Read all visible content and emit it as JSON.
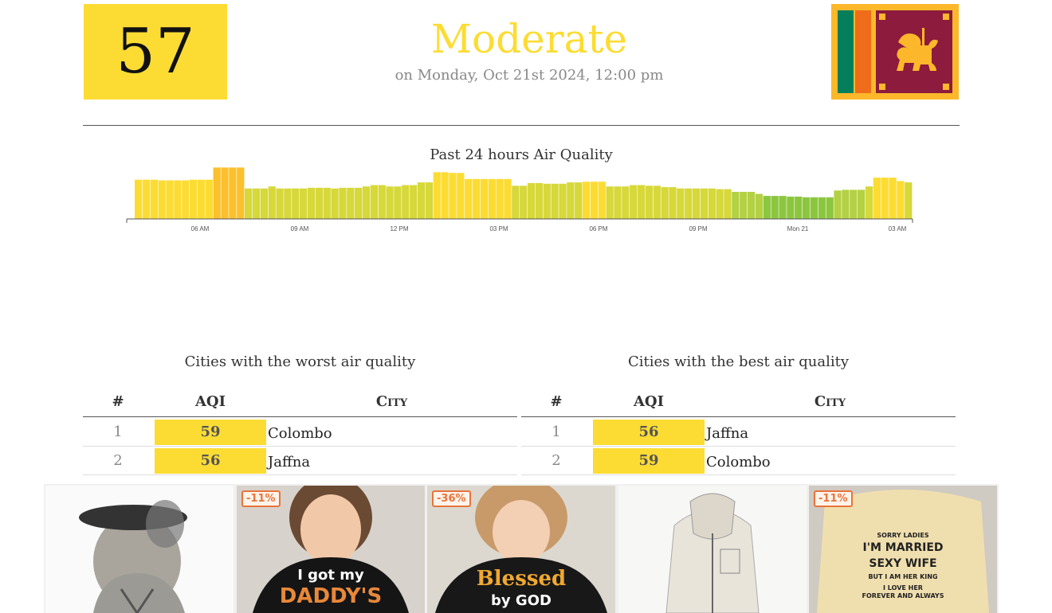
{
  "header": {
    "aqi_value": "57",
    "status": "Moderate",
    "timestamp": "on Monday, Oct 21st 2024, 12:00 pm",
    "colors": {
      "moderate": "#fcdc33"
    }
  },
  "chart": {
    "title": "Past 24 hours Air Quality"
  },
  "chart_data": {
    "type": "bar",
    "title": "Past 24 hours Air Quality",
    "x_tick_labels": [
      "06 AM",
      "09 AM",
      "12 PM",
      "03 PM",
      "06 PM",
      "09 PM",
      "Mon 21",
      "03 AM"
    ],
    "values": [
      58,
      58,
      58,
      57,
      57,
      57,
      57,
      58,
      58,
      58,
      76,
      76,
      76,
      76,
      45,
      45,
      45,
      48,
      45,
      45,
      45,
      45,
      46,
      46,
      46,
      45,
      46,
      46,
      46,
      48,
      50,
      50,
      48,
      48,
      50,
      50,
      54,
      54,
      69,
      69,
      68,
      68,
      59,
      59,
      59,
      59,
      59,
      59,
      49,
      49,
      53,
      53,
      52,
      52,
      52,
      54,
      54,
      55,
      55,
      55,
      48,
      48,
      48,
      50,
      50,
      49,
      49,
      47,
      47,
      45,
      45,
      45,
      45,
      45,
      44,
      44,
      40,
      40,
      40,
      37,
      34,
      34,
      34,
      33,
      33,
      32,
      32,
      32,
      32,
      42,
      43,
      43,
      43,
      48,
      61,
      61,
      61,
      56,
      54
    ],
    "ylim": [
      0,
      100
    ],
    "grid": false
  },
  "worst": {
    "title": "Cities with the worst air quality",
    "headers": {
      "rank": "#",
      "aqi": "AQI",
      "city": "City"
    },
    "rows": [
      {
        "rank": "1",
        "aqi": "59",
        "city": "Colombo"
      },
      {
        "rank": "2",
        "aqi": "56",
        "city": "Jaffna"
      }
    ]
  },
  "best": {
    "title": "Cities with the best air quality",
    "headers": {
      "rank": "#",
      "aqi": "AQI",
      "city": "City"
    },
    "rows": [
      {
        "rank": "1",
        "aqi": "56",
        "city": "Jaffna"
      },
      {
        "rank": "2",
        "aqi": "59",
        "city": "Colombo"
      }
    ]
  },
  "ads": {
    "badges": [
      "-11%",
      "-36%",
      "-11%"
    ],
    "shirt1": [
      "I got my",
      "DADDY'S"
    ],
    "shirt2": [
      "Blessed",
      "by GOD"
    ],
    "shirt3": [
      "SORRY LADIES",
      "I'M MARRIED",
      "SEXY WIFE",
      "BUT I AM HER KING",
      "I LOVE HER",
      "FOREVER AND ALWAYS"
    ],
    "adchoices_icon": "adchoices-icon",
    "close_icon": "close-icon"
  }
}
